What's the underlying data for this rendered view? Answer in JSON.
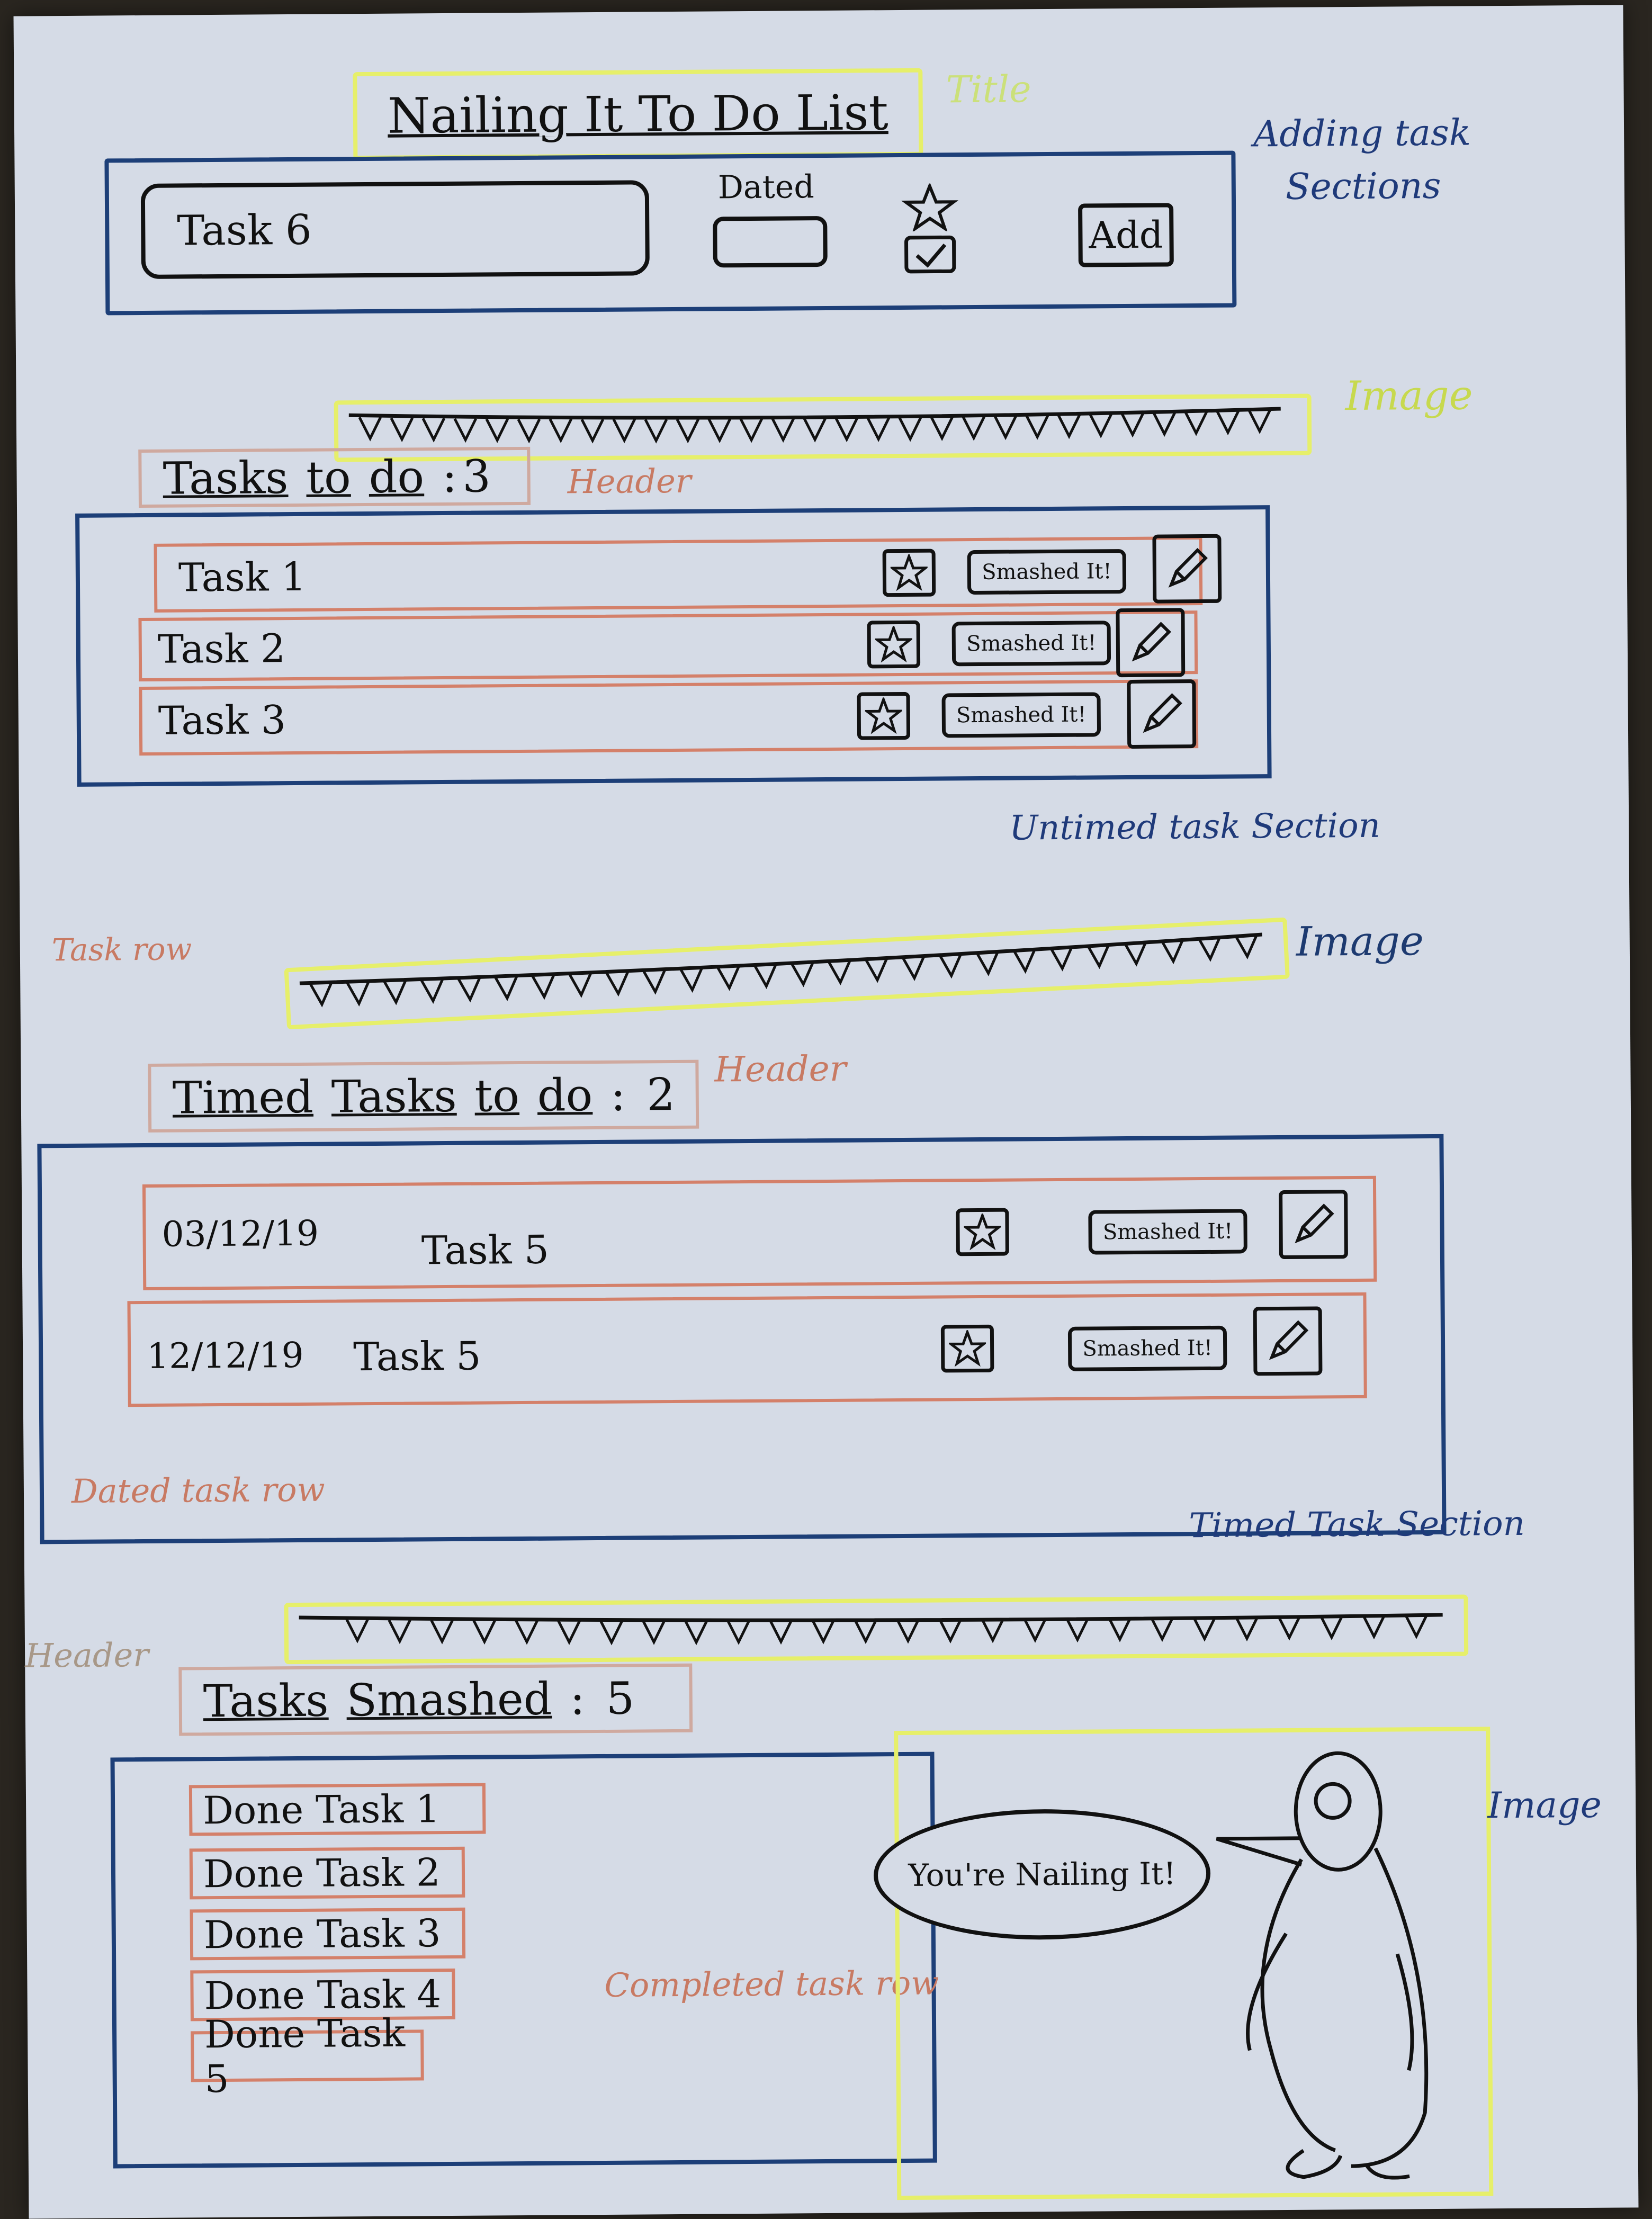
{
  "title": "Nailing It To Do List",
  "notes": {
    "title_note": "Title",
    "adding_note_1": "Adding task",
    "adding_note_2": "Sections",
    "image_note_1": "Image",
    "header_note_1": "Header",
    "untimed_note": "Untimed task Section",
    "task_row_note": "Task row",
    "image_note_2": "Image",
    "header_note_2": "Header",
    "dated_row_note": "Dated task row",
    "timed_note": "Timed Task Section",
    "header_note_3": "Header",
    "image_note_3": "Image",
    "completed_row_note": "Completed task row"
  },
  "add_section": {
    "task_input_value": "Task 6",
    "dated_label": "Dated",
    "add_label": "Add"
  },
  "untimed": {
    "header_words": [
      "Tasks",
      "to",
      "do",
      ":",
      "3"
    ],
    "rows": [
      {
        "name": "Task 1",
        "smash": "Smashed It!"
      },
      {
        "name": "Task 2",
        "smash": "Smashed It!"
      },
      {
        "name": "Task 3",
        "smash": "Smashed It!"
      }
    ]
  },
  "timed": {
    "header_words": [
      "Timed",
      "Tasks",
      "to",
      "do",
      ":",
      "2"
    ],
    "rows": [
      {
        "date": "03/12/19",
        "name": "Task 5",
        "smash": "Smashed It!"
      },
      {
        "date": "12/12/19",
        "name": "Task 5",
        "smash": "Smashed It!"
      }
    ]
  },
  "smashed": {
    "header_words": [
      "Tasks",
      "Smashed",
      ":",
      "5"
    ],
    "rows": [
      "Done Task 1",
      "Done Task 2",
      "Done Task 3",
      "Done Task 4",
      "Done Task 5"
    ]
  },
  "speech_bubble": "You're Nailing It!",
  "icons": [
    "star-icon",
    "check-icon",
    "pencil-icon",
    "bunting-image",
    "penguin-image"
  ],
  "colors": {
    "paper": "#d5dbe6",
    "section_border": "#1d3f78",
    "image_highlight": "#e6ef6a",
    "row_border": "#d4806a",
    "ink": "#111111"
  }
}
